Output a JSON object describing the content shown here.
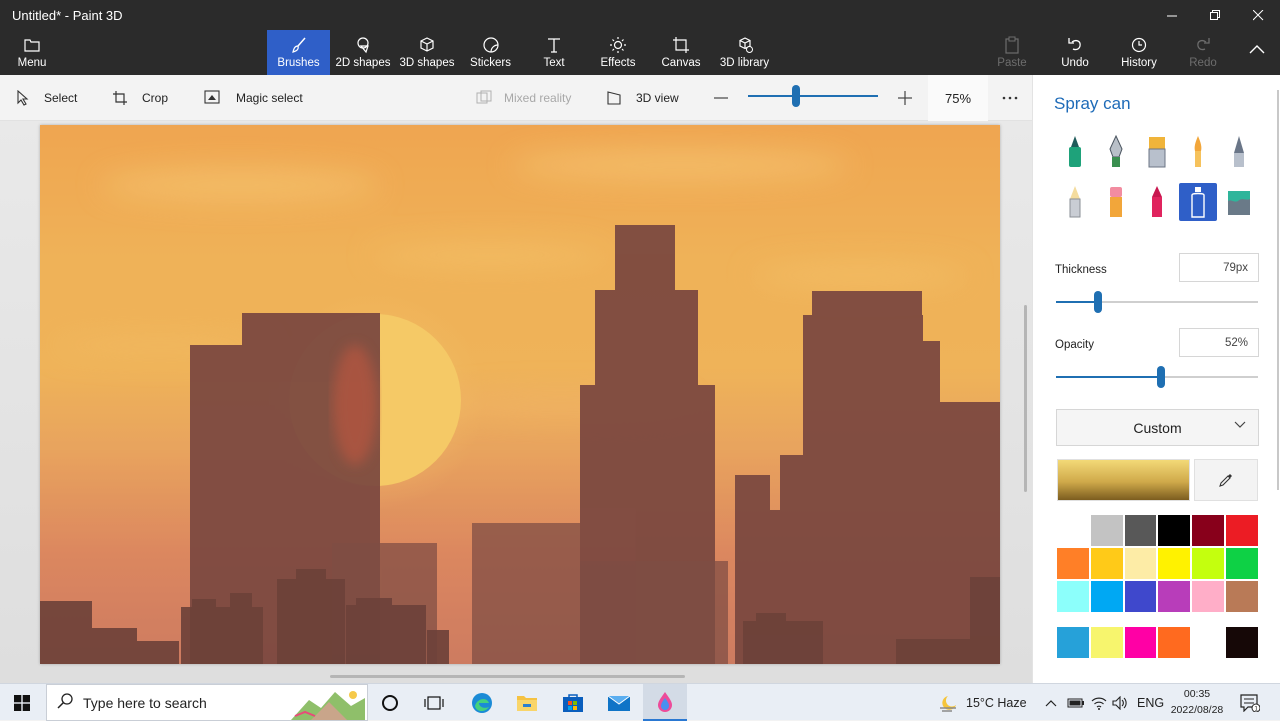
{
  "window": {
    "title": "Untitled* - Paint 3D"
  },
  "ribbon": {
    "menu_label": "Menu",
    "tools": [
      {
        "label": "Brushes",
        "icon": "brush-icon",
        "active": true
      },
      {
        "label": "2D shapes",
        "icon": "2d-shapes-icon"
      },
      {
        "label": "3D shapes",
        "icon": "3d-shapes-icon"
      },
      {
        "label": "Stickers",
        "icon": "stickers-icon"
      },
      {
        "label": "Text",
        "icon": "text-icon"
      },
      {
        "label": "Effects",
        "icon": "effects-icon"
      },
      {
        "label": "Canvas",
        "icon": "canvas-icon"
      },
      {
        "label": "3D library",
        "icon": "3d-library-icon"
      }
    ],
    "actions": [
      {
        "label": "Paste",
        "icon": "paste-icon",
        "enabled": false
      },
      {
        "label": "Undo",
        "icon": "undo-icon",
        "enabled": true
      },
      {
        "label": "History",
        "icon": "history-icon",
        "enabled": true
      },
      {
        "label": "Redo",
        "icon": "redo-icon",
        "enabled": false
      }
    ]
  },
  "toolbar": {
    "select": "Select",
    "crop": "Crop",
    "magic_select": "Magic select",
    "mixed_reality": "Mixed reality",
    "view_3d": "3D view",
    "zoom": "75%",
    "zoom_fraction": 0.37
  },
  "panel": {
    "title": "Spray can",
    "selected_brush": "spray-can",
    "thickness_label": "Thickness",
    "thickness_value": "79px",
    "thickness_fraction": 0.21,
    "opacity_label": "Opacity",
    "opacity_value": "52%",
    "opacity_fraction": 0.52,
    "color_mode": "Custom",
    "palette": [
      "#ffffff",
      "#c3c3c3",
      "#585858",
      "#000000",
      "#88001b",
      "#ec1c24",
      "#ff7f27",
      "#ffca18",
      "#fdeca6",
      "#fff200",
      "#c4ff0e",
      "#0ed145",
      "#8cfffb",
      "#00a8f3",
      "#3f48cc",
      "#b83dba",
      "#ffaec8",
      "#b97a57"
    ],
    "custom_colors": [
      "#26a1d9",
      "#f7f56d",
      "#ff00a5",
      "#ff6a1f",
      "#ffffff",
      "#160807"
    ]
  },
  "taskbar": {
    "search_placeholder": "Type here to search",
    "weather": "15°C  Haze",
    "language": "ENG",
    "time": "00:35",
    "date": "2022/08/28"
  }
}
